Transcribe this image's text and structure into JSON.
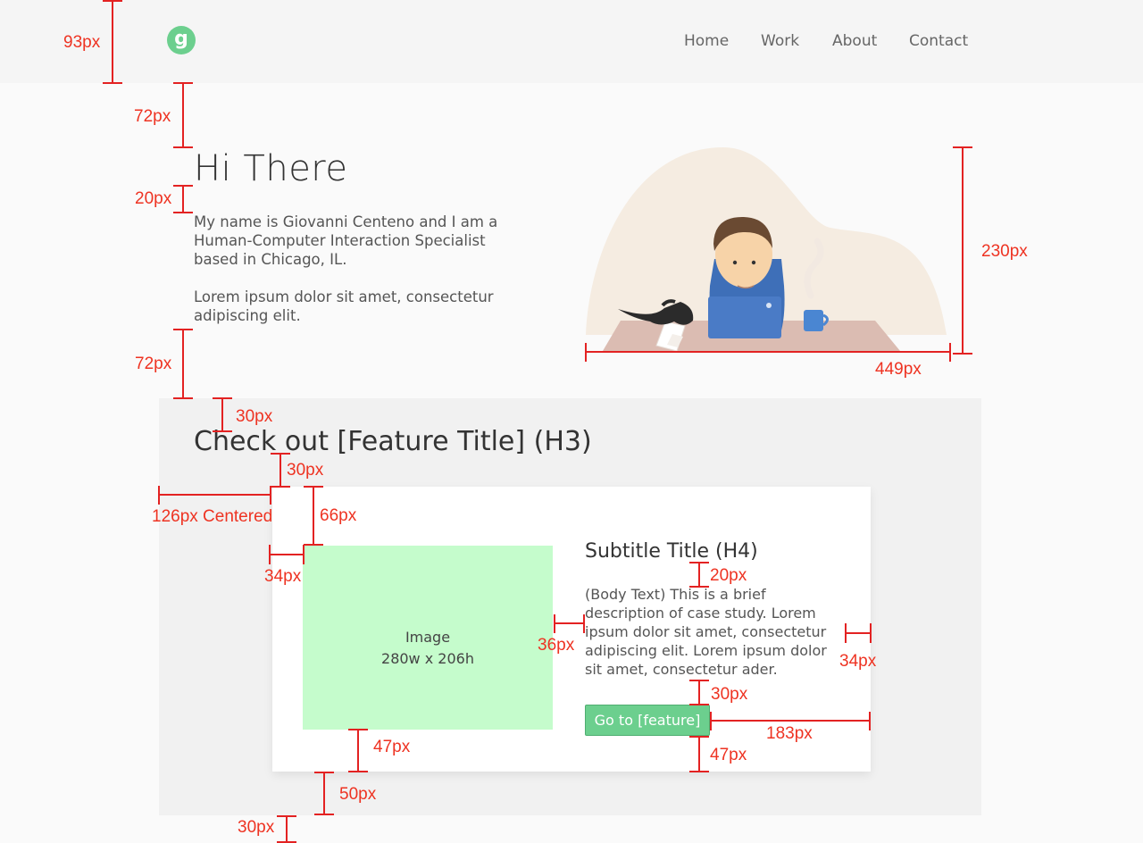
{
  "header": {
    "logo_letter": "g",
    "nav": [
      "Home",
      "Work",
      "About",
      "Contact"
    ]
  },
  "hero": {
    "title": "Hi There",
    "p1": "My name is Giovanni Centeno and I am a Human-Computer Interaction Specialist based in Chicago, IL.",
    "p2": "Lorem ipsum dolor sit amet, consectetur adipiscing elit."
  },
  "feature": {
    "title": "Check out [Feature Title] (H3)",
    "card": {
      "image_label": "Image",
      "image_size": "280w x 206h",
      "subtitle": "Subtitle Title (H4)",
      "body": "(Body Text) This is a brief description of case study. Lorem ipsum dolor sit amet, consectetur adipiscing elit. Lorem ipsum dolor sit amet, consectetur ader.",
      "button": "Go to [feature]"
    }
  },
  "annotations": {
    "a93": "93px",
    "a72a": "72px",
    "a20a": "20px",
    "a72b": "72px",
    "a30a": "30px",
    "a30b": "30px",
    "a126": "126px Centered",
    "a66": "66px",
    "a34a": "34px",
    "a20b": "20px",
    "a36": "36px",
    "a34b": "34px",
    "a30c": "30px",
    "a183": "183px",
    "a47a": "47px",
    "a47b": "47px",
    "a50": "50px",
    "a30d": "30px",
    "a230": "230px",
    "a449": "449px"
  },
  "colors": {
    "accent_green": "#6ccf8e",
    "image_placeholder": "#c5fccc",
    "annotation_red": "#e32222"
  }
}
